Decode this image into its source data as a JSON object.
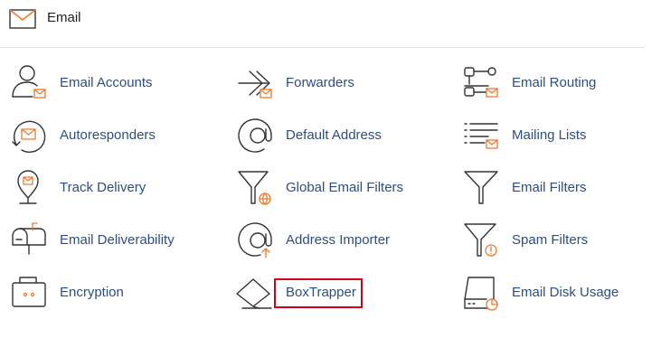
{
  "header": {
    "title": "Email",
    "icon": "envelope-icon"
  },
  "colors": {
    "link": "#2b4f84",
    "accent": "#ef7a2c",
    "highlight": "#d0021b"
  },
  "items": [
    {
      "label": "Email Accounts",
      "icon": "email-accounts-icon"
    },
    {
      "label": "Forwarders",
      "icon": "forwarders-icon"
    },
    {
      "label": "Email Routing",
      "icon": "email-routing-icon"
    },
    {
      "label": "Autoresponders",
      "icon": "autoresponders-icon"
    },
    {
      "label": "Default Address",
      "icon": "default-address-icon"
    },
    {
      "label": "Mailing Lists",
      "icon": "mailing-lists-icon"
    },
    {
      "label": "Track Delivery",
      "icon": "track-delivery-icon"
    },
    {
      "label": "Global Email Filters",
      "icon": "global-email-filters-icon"
    },
    {
      "label": "Email Filters",
      "icon": "email-filters-icon"
    },
    {
      "label": "Email Deliverability",
      "icon": "email-deliverability-icon"
    },
    {
      "label": "Address Importer",
      "icon": "address-importer-icon"
    },
    {
      "label": "Spam Filters",
      "icon": "spam-filters-icon"
    },
    {
      "label": "Encryption",
      "icon": "encryption-icon"
    },
    {
      "label": "BoxTrapper",
      "icon": "boxtrapper-icon"
    },
    {
      "label": "Email Disk Usage",
      "icon": "email-disk-usage-icon"
    }
  ]
}
